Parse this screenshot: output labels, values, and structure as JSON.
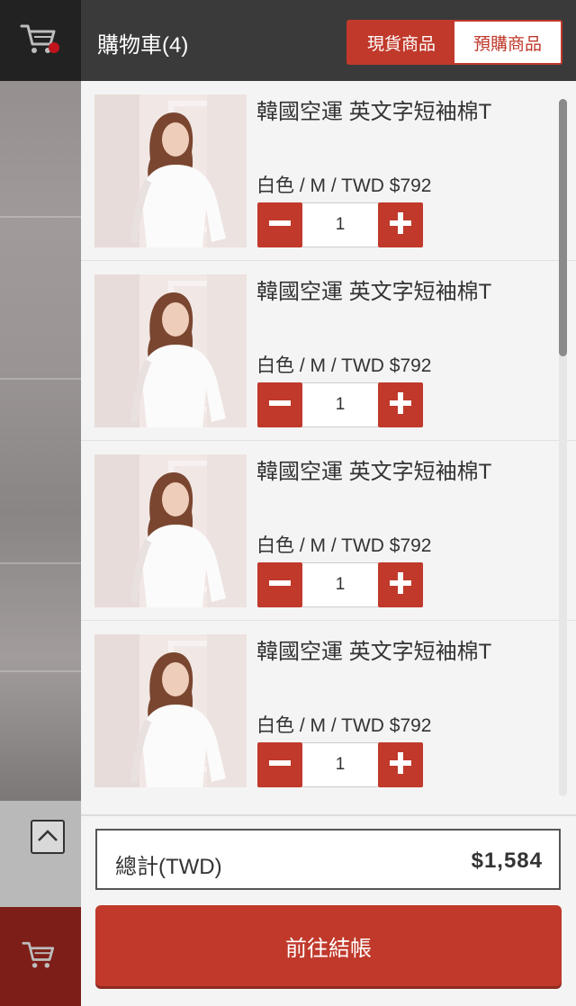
{
  "header": {
    "cart_title": "購物車(4)",
    "tabs": [
      {
        "label": "現貨商品",
        "active": true
      },
      {
        "label": "預購商品",
        "active": false
      }
    ]
  },
  "items": [
    {
      "name": "韓國空運 英文字短袖棉T",
      "spec": "白色 / M / TWD $792",
      "quantity": "1"
    },
    {
      "name": "韓國空運 英文字短袖棉T",
      "spec": "白色 / M / TWD $792",
      "quantity": "1"
    },
    {
      "name": "韓國空運 英文字短袖棉T",
      "spec": "白色 / M / TWD $792",
      "quantity": "1"
    },
    {
      "name": "韓國空運 英文字短袖棉T",
      "spec": "白色 / M / TWD $792",
      "quantity": "1"
    }
  ],
  "summary": {
    "total_label": "總計(TWD)",
    "total_value": "$1,584"
  },
  "checkout_label": "前往結帳",
  "colors": {
    "accent": "#c0392b",
    "header_bg": "#3a3a3a",
    "rail_top": "#222222",
    "rail_bottom": "#7d1f18"
  },
  "icons": {
    "rail_top": "cart-with-badge-icon",
    "rail_bottom": "cart-icon",
    "scroll_up": "chevron-up-icon",
    "minus": "minus-icon",
    "plus": "plus-icon"
  }
}
